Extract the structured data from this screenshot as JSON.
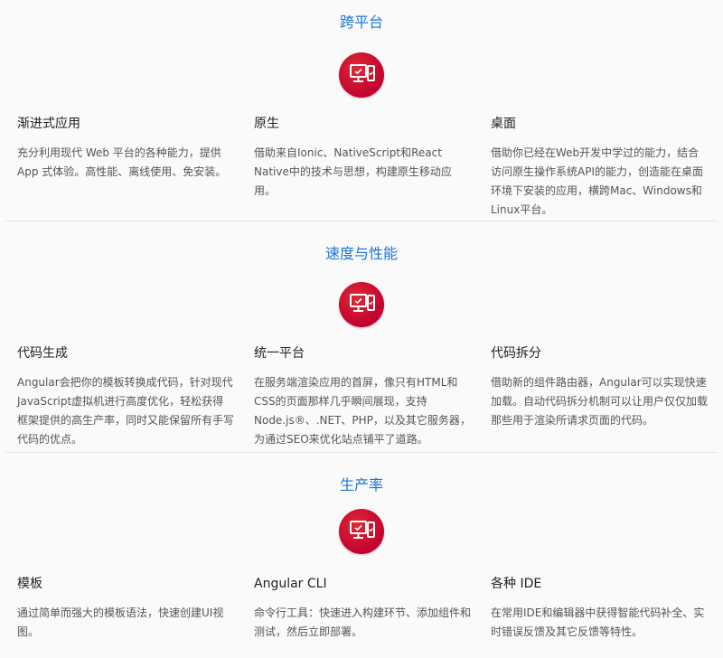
{
  "colors": {
    "accent": "#1976d2",
    "badge": "#c3002f",
    "background": "#fafafa"
  },
  "sections": [
    {
      "title": "跨平台",
      "icon": "devices-icon",
      "features": [
        {
          "title": "渐进式应用",
          "desc": "充分利用现代 Web 平台的各种能力，提供 App 式体验。高性能、离线使用、免安装。"
        },
        {
          "title": "原生",
          "desc": "借助来自Ionic、NativeScript和React Native中的技术与思想，构建原生移动应用。"
        },
        {
          "title": "桌面",
          "desc": "借助你已经在Web开发中学过的能力，结合访问原生操作系统API的能力，创造能在桌面环境下安装的应用，横跨Mac、Windows和Linux平台。"
        }
      ]
    },
    {
      "title": "速度与性能",
      "icon": "devices-icon",
      "features": [
        {
          "title": "代码生成",
          "desc": "Angular会把你的模板转换成代码，针对现代JavaScript虚拟机进行高度优化，轻松获得框架提供的高生产率，同时又能保留所有手写代码的优点。"
        },
        {
          "title": "统一平台",
          "desc": "在服务端渲染应用的首屏，像只有HTML和CSS的页面那样几乎瞬间展现，支持Node.js®、.NET、PHP，以及其它服务器，为通过SEO来优化站点铺平了道路。"
        },
        {
          "title": "代码拆分",
          "desc": "借助新的组件路由器，Angular可以实现快速加载。自动代码拆分机制可以让用户仅仅加载那些用于渲染所请求页面的代码。"
        }
      ]
    },
    {
      "title": "生产率",
      "icon": "devices-icon",
      "features": [
        {
          "title": "模板",
          "desc": "通过简单而强大的模板语法，快速创建UI视图。"
        },
        {
          "title": "Angular CLI",
          "desc": "命令行工具：快速进入构建环节、添加组件和测试，然后立即部署。"
        },
        {
          "title": "各种 IDE",
          "desc": "在常用IDE和编辑器中获得智能代码补全、实时错误反馈及其它反馈等特性。"
        }
      ]
    }
  ]
}
